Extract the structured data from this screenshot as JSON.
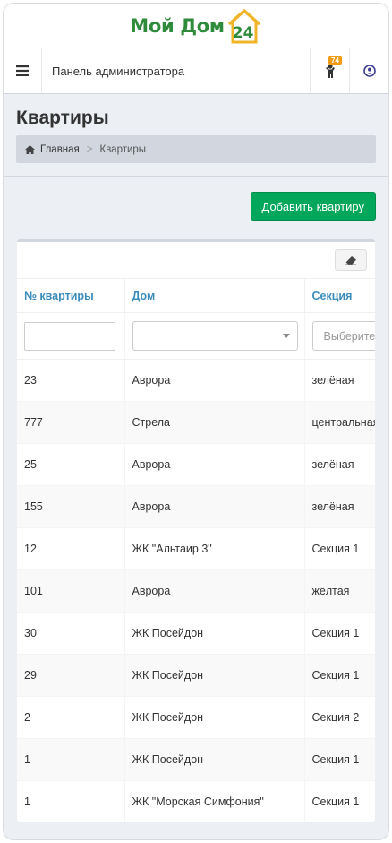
{
  "logo": {
    "text": "Мой Дом",
    "number": "24"
  },
  "navbar": {
    "title": "Панель администратора",
    "notification_count": "74"
  },
  "page": {
    "title": "Квартиры"
  },
  "breadcrumb": {
    "home": "Главная",
    "separator": ">",
    "current": "Квартиры"
  },
  "actions": {
    "add_label": "Добавить квартиру"
  },
  "colors": {
    "accent": "#3c8dbc",
    "success": "#00a65a",
    "logo": "#2e8b3b",
    "badge": "#f39c12"
  },
  "table": {
    "headers": {
      "number": "№ квартиры",
      "house": "Дом",
      "section": "Секция"
    },
    "filters": {
      "section_placeholder": "Выберите..."
    },
    "rows": [
      {
        "number": "23",
        "house": "Аврора",
        "section": "зелёная"
      },
      {
        "number": "777",
        "house": "Стрела",
        "section": "центральная"
      },
      {
        "number": "25",
        "house": "Аврора",
        "section": "зелёная"
      },
      {
        "number": "155",
        "house": "Аврора",
        "section": "зелёная"
      },
      {
        "number": "12",
        "house": "ЖК \"Альтаир 3\"",
        "section": "Секция 1"
      },
      {
        "number": "101",
        "house": "Аврора",
        "section": "жёлтая"
      },
      {
        "number": "30",
        "house": "ЖК Посейдон",
        "section": "Секция 1"
      },
      {
        "number": "29",
        "house": "ЖК Посейдон",
        "section": "Секция 1"
      },
      {
        "number": "2",
        "house": "ЖК Посейдон",
        "section": "Секция 2"
      },
      {
        "number": "1",
        "house": "ЖК Посейдон",
        "section": "Секция 1"
      },
      {
        "number": "1",
        "house": "ЖК \"Морская Симфония\"",
        "section": "Секция 1"
      }
    ]
  }
}
